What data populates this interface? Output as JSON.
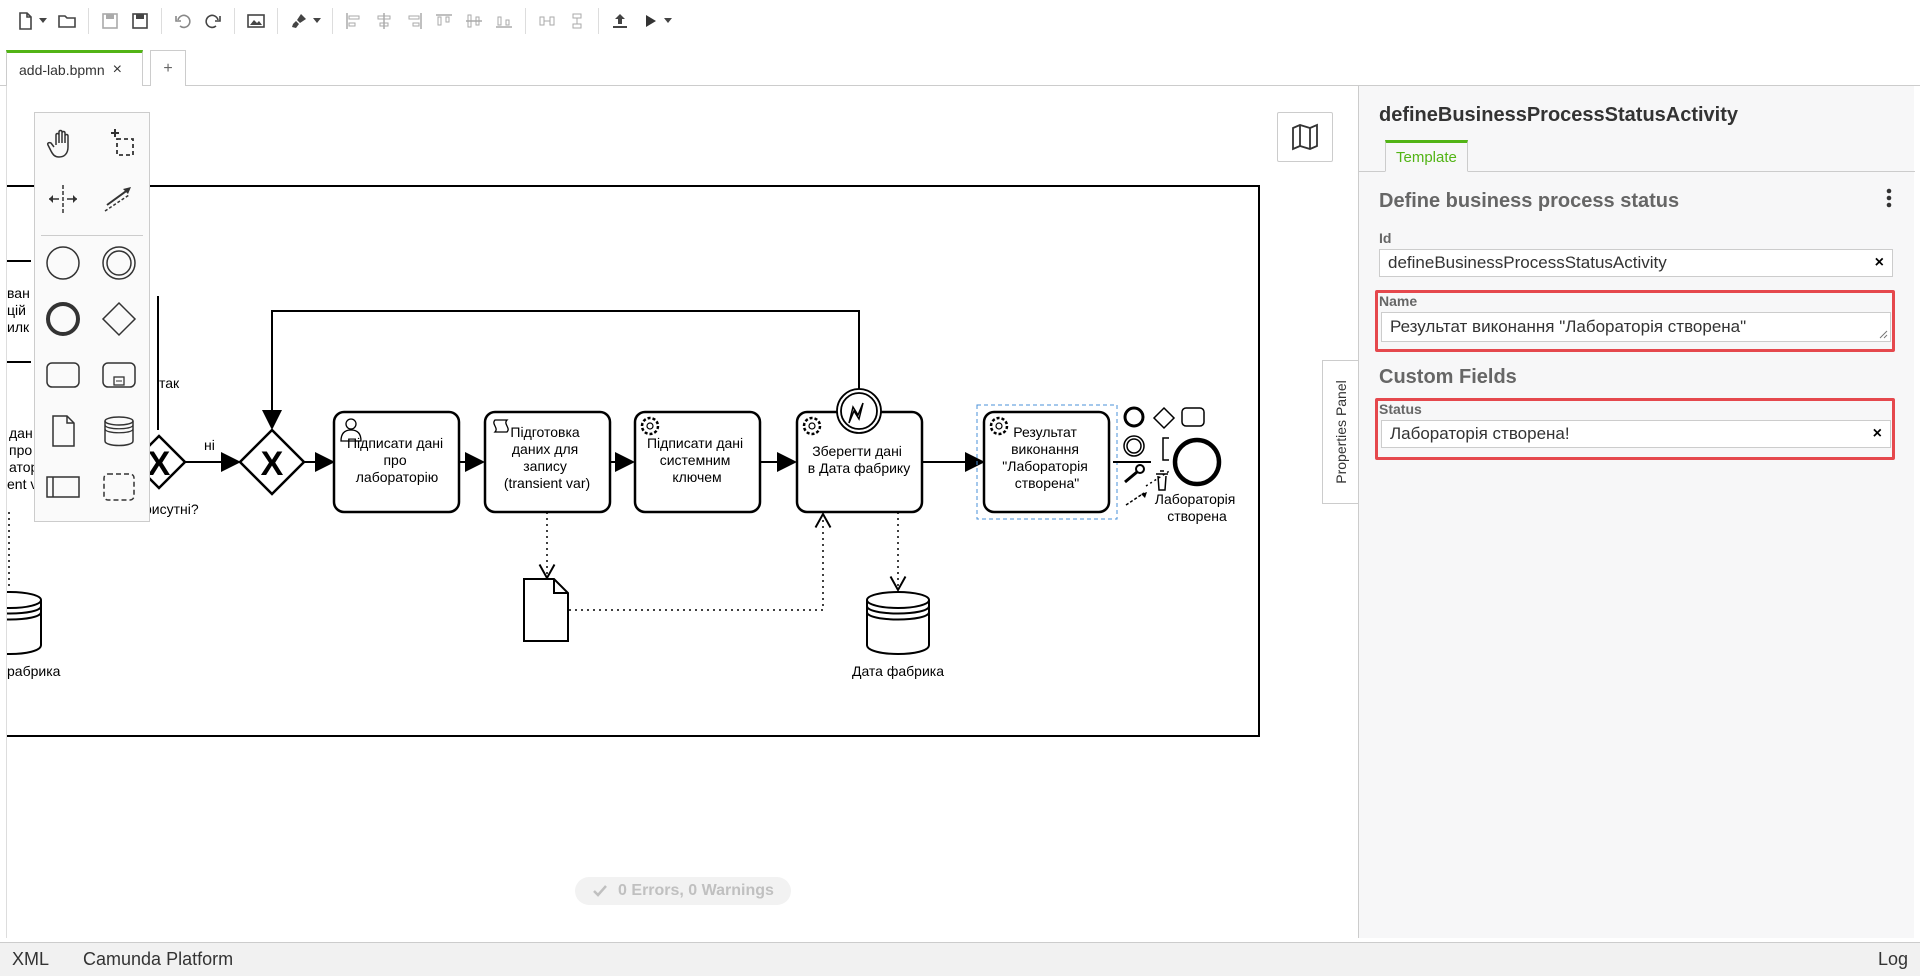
{
  "toolbar": {
    "icons": [
      "new-file-icon",
      "open-folder-icon",
      "save-icon",
      "save-as-icon",
      "undo-icon",
      "redo-icon",
      "image-export-icon",
      "brush-icon",
      "align-left-icon",
      "align-center-icon",
      "align-right-icon",
      "align-top-icon",
      "align-middle-icon",
      "align-bottom-icon",
      "distribute-horizontal-icon",
      "distribute-vertical-icon",
      "deploy-icon",
      "run-icon"
    ]
  },
  "tabs": {
    "active": "add-lab.bpmn",
    "close": "×",
    "add": "+"
  },
  "diagram": {
    "partial_labels": {
      "left_1": "ван",
      "left_2": "цій",
      "left_3": "илк",
      "left_4": "дан",
      "left_5": "про",
      "left_6": "атор",
      "left_7": "ent v",
      "tak": "так",
      "present": "рисутні?",
      "ni": "ні",
      "left_store": "рабрика"
    },
    "tasks": {
      "sign_lab": [
        "Підписати дані",
        "про",
        "лабораторію"
      ],
      "prepare": [
        "Підготовка",
        "даних для",
        "запису",
        "(transient var)"
      ],
      "sign_key": [
        "Підписати дані",
        "системним",
        "ключем"
      ],
      "save": [
        "Зберегти дані",
        "в Дата фабрику"
      ],
      "result": [
        "Результат",
        "виконання",
        "\"Лабораторія",
        "створена\""
      ]
    },
    "datastore": "Дата фабрика",
    "end_event": [
      "Лабораторія",
      "створена"
    ]
  },
  "status": {
    "text": "0 Errors, 0 Warnings"
  },
  "properties_toggle": "Properties Panel",
  "properties": {
    "element_id": "defineBusinessProcessStatusActivity",
    "tab": "Template",
    "group_title": "Define business process status",
    "id_label": "Id",
    "id_value": "defineBusinessProcessStatusActivity",
    "name_label": "Name",
    "name_value": "Результат виконання \"Лабораторія створена\"",
    "custom_title": "Custom Fields",
    "status_label": "Status",
    "status_value": "Лабораторія створена!",
    "clear": "×"
  },
  "footer": {
    "xml": "XML",
    "platform": "Camunda Platform",
    "log": "Log"
  },
  "colors": {
    "accent": "#52b415",
    "highlight": "#e5484d"
  }
}
